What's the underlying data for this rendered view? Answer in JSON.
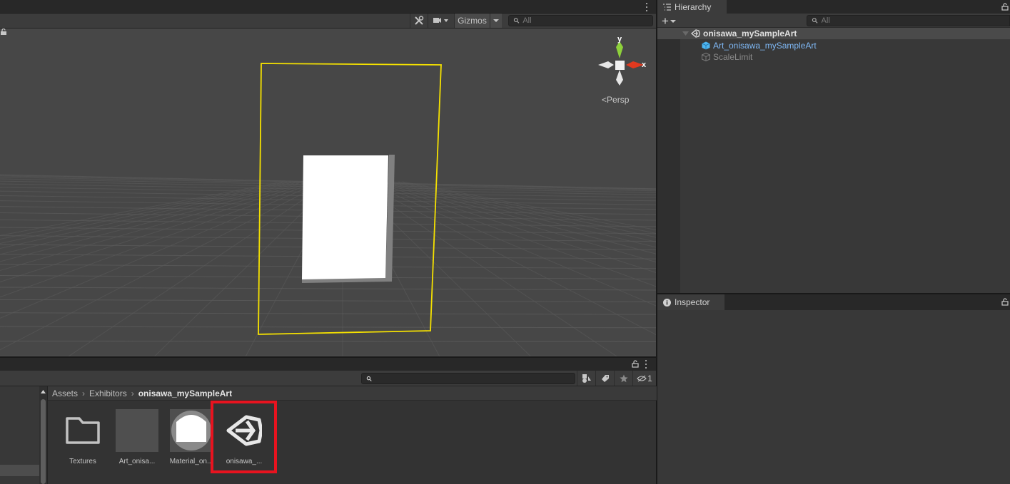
{
  "scene_view": {
    "toolbar": {
      "tools_icon": "tools-icon",
      "camera_icon": "camera-icon",
      "gizmos_label": "Gizmos",
      "search_placeholder": "All"
    },
    "orientation_gizmo": {
      "y_label": "y",
      "x_label": "x",
      "projection_label": "Persp",
      "colors": {
        "y_axis": "#8ed13b",
        "x_axis": "#e0391f",
        "neutral": "#e6e6e6"
      }
    },
    "selection_outline_color": "#f5e100",
    "object_color": "#ffffff",
    "object_shadow_color": "#808080",
    "background_color": "#474747"
  },
  "hierarchy": {
    "tab_label": "Hierarchy",
    "add_label": "+",
    "search_placeholder": "All",
    "scene": {
      "name": "onisawa_mySampleArt",
      "children": [
        {
          "name": "Art_onisawa_mySampleArt",
          "color": "#7fb8f5",
          "icon": "prefab-cube-icon"
        },
        {
          "name": "ScaleLimit",
          "color": "#8a8a8a",
          "icon": "gameobject-cube-icon"
        }
      ]
    }
  },
  "inspector": {
    "tab_label": "Inspector"
  },
  "project": {
    "search_placeholder": "",
    "hidden_count": "1",
    "breadcrumb": [
      "Assets",
      "Exhibitors",
      "onisawa_mySampleArt"
    ],
    "assets": [
      {
        "label": "Textures",
        "type": "folder"
      },
      {
        "label": "Art_onisa...",
        "type": "prefab"
      },
      {
        "label": "Material_on...",
        "type": "material"
      },
      {
        "label": "onisawa_...",
        "type": "scene"
      }
    ],
    "highlight_color": "#e8131f"
  }
}
